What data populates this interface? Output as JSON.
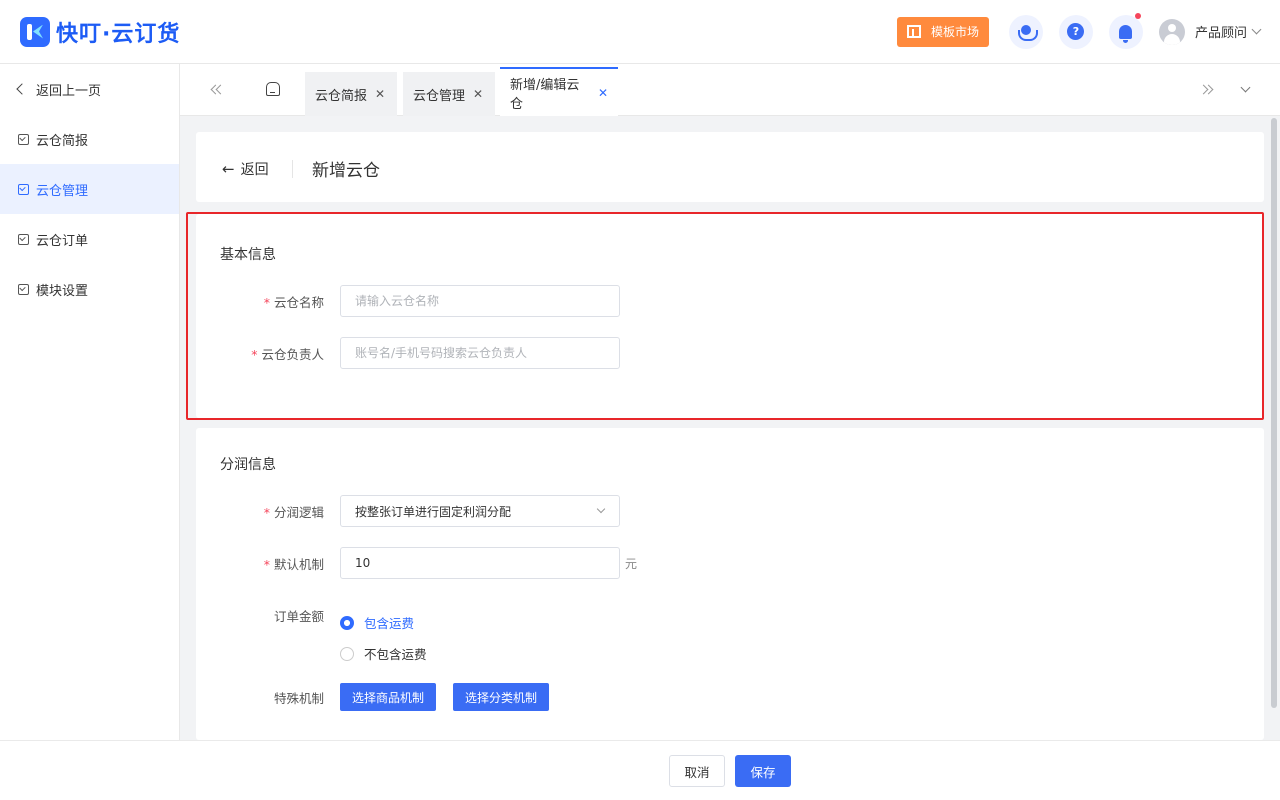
{
  "header": {
    "logo_text": "快叮·云订货",
    "market_button": "模板市场",
    "user_name": "产品顾问"
  },
  "sidebar": {
    "back_label": "返回上一页",
    "items": [
      {
        "label": "云仓简报",
        "active": false
      },
      {
        "label": "云仓管理",
        "active": true
      },
      {
        "label": "云仓订单",
        "active": false
      },
      {
        "label": "模块设置",
        "active": false
      }
    ]
  },
  "tabs": [
    {
      "label": "云仓简报",
      "active": false
    },
    {
      "label": "云仓管理",
      "active": false
    },
    {
      "label": "新增/编辑云仓",
      "active": true
    }
  ],
  "page": {
    "back_label": "返回",
    "title": "新增云仓"
  },
  "basic_info": {
    "section_title": "基本信息",
    "name_label": "云仓名称",
    "name_placeholder": "请输入云仓名称",
    "owner_label": "云仓负责人",
    "owner_placeholder": "账号名/手机号码搜索云仓负责人"
  },
  "profit_info": {
    "section_title": "分润信息",
    "logic_label": "分润逻辑",
    "logic_value": "按整张订单进行固定利润分配",
    "default_label": "默认机制",
    "default_value": "10",
    "default_unit": "元",
    "order_amount_label": "订单金额",
    "radio_options": [
      {
        "label": "包含运费",
        "checked": true
      },
      {
        "label": "不包含运费",
        "checked": false
      }
    ],
    "special_label": "特殊机制",
    "btn_goods": "选择商品机制",
    "btn_category": "选择分类机制"
  },
  "footer": {
    "cancel": "取消",
    "save": "保存"
  },
  "colors": {
    "primary": "#3a6cf4",
    "accent_orange": "#ff8a3d",
    "highlight_red": "#e8262a"
  }
}
